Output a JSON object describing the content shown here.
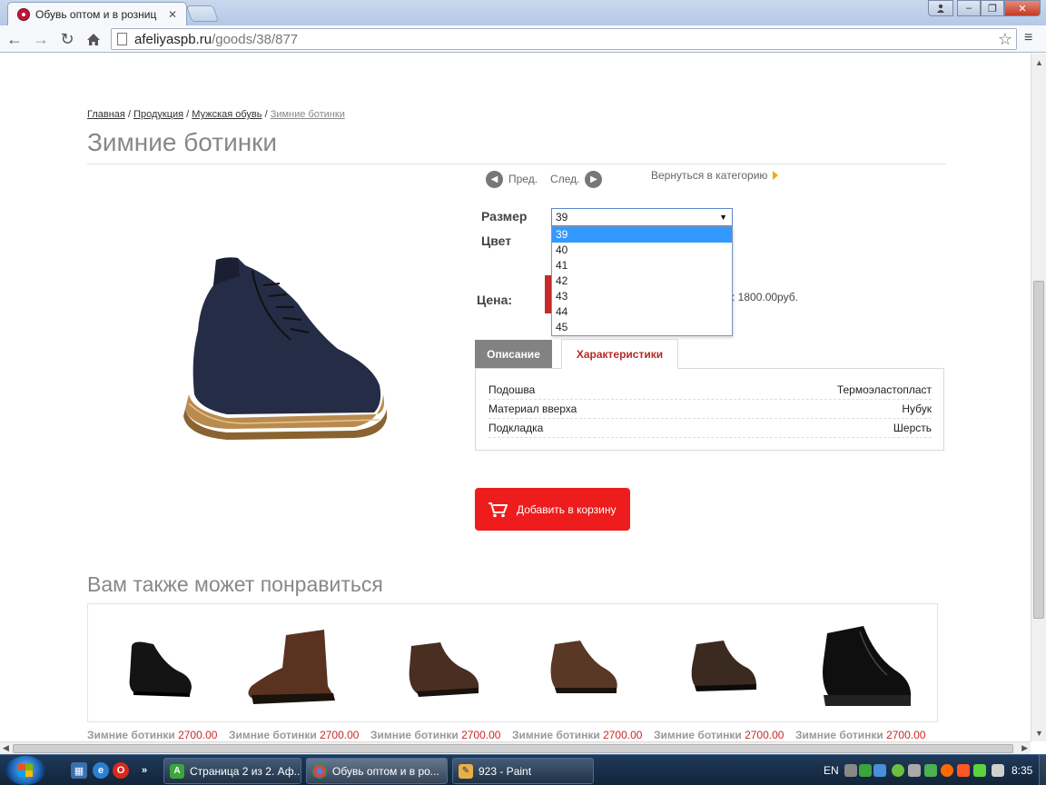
{
  "browser": {
    "tab_title": "Обувь оптом и в розниц",
    "url_host": "afeliyaspb.ru",
    "url_path": "/goods/38/877"
  },
  "breadcrumb": {
    "items": [
      "Главная",
      "Продукция",
      "Мужская обувь"
    ],
    "separator": "/",
    "current": "Зимние ботинки"
  },
  "product": {
    "title": "Зимние ботинки",
    "prev_label": "Пред.",
    "next_label": "След.",
    "back_to_category": "Вернуться в категорию",
    "size_label": "Размер",
    "color_label": "Цвет",
    "price_label": "Цена:",
    "price_text": ": 1800.00руб.",
    "size_selected": "39",
    "size_options": [
      "39",
      "40",
      "41",
      "42",
      "43",
      "44",
      "45"
    ],
    "tabs": [
      "Описание",
      "Характеристики"
    ],
    "active_tab": "Характеристики",
    "characteristics": [
      {
        "key": "Подошва",
        "value": "Термоэластопласт"
      },
      {
        "key": "Материал вверха",
        "value": "Нубук"
      },
      {
        "key": "Подкладка",
        "value": "Шерсть"
      }
    ],
    "add_to_cart": "Добавить в корзину"
  },
  "related": {
    "title": "Вам также может понравиться",
    "items": [
      {
        "name": "Зимние ботинки",
        "price": "2700.00"
      },
      {
        "name": "Зимние ботинки",
        "price": "2700.00"
      },
      {
        "name": "Зимние ботинки",
        "price": "2700.00"
      },
      {
        "name": "Зимние ботинки",
        "price": "2700.00"
      },
      {
        "name": "Зимние ботинки",
        "price": "2700.00"
      },
      {
        "name": "Зимние ботинки",
        "price": "2700.00"
      }
    ]
  },
  "taskbar": {
    "tasks": [
      {
        "label": "Страница 2 из 2. Аф..."
      },
      {
        "label": "Обувь оптом и в ро..."
      },
      {
        "label": "923 - Paint"
      }
    ],
    "lang": "EN",
    "time": "8:35"
  },
  "colors": {
    "accent_red": "#ee1c1c",
    "tab_active_text": "#b32a2a",
    "selection_blue": "#3399ff"
  }
}
